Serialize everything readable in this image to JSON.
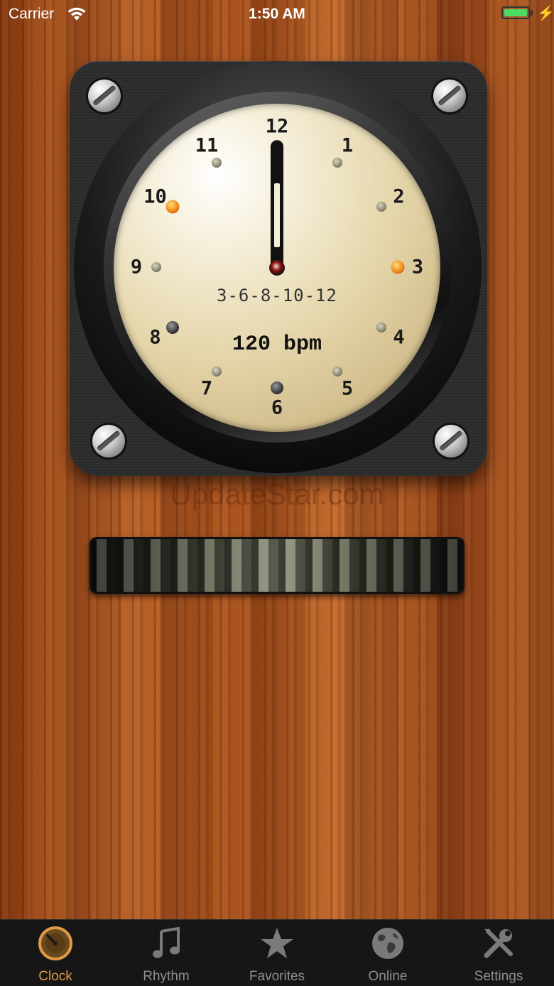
{
  "status_bar": {
    "carrier": "Carrier",
    "time": "1:50 AM",
    "battery_level": 1.0
  },
  "dial": {
    "numerals": [
      "12",
      "1",
      "2",
      "3",
      "4",
      "5",
      "6",
      "7",
      "8",
      "9",
      "10",
      "11"
    ],
    "accent_beats": [
      "3",
      "10"
    ],
    "pattern": "3-6-8-10-12",
    "tempo": "120 bpm"
  },
  "watermark": "UpdateStar.com",
  "tab_bar": {
    "items": [
      {
        "label": "Clock",
        "icon": "clock-icon",
        "active": true
      },
      {
        "label": "Rhythm",
        "icon": "music-note-icon",
        "active": false
      },
      {
        "label": "Favorites",
        "icon": "star-icon",
        "active": false
      },
      {
        "label": "Online",
        "icon": "globe-icon",
        "active": false
      },
      {
        "label": "Settings",
        "icon": "tools-icon",
        "active": false
      }
    ]
  },
  "colors": {
    "accent": "#e19a46",
    "inactive": "#8e8e8e",
    "accent_dot": "#f08a1a",
    "battery": "#4cd964"
  }
}
